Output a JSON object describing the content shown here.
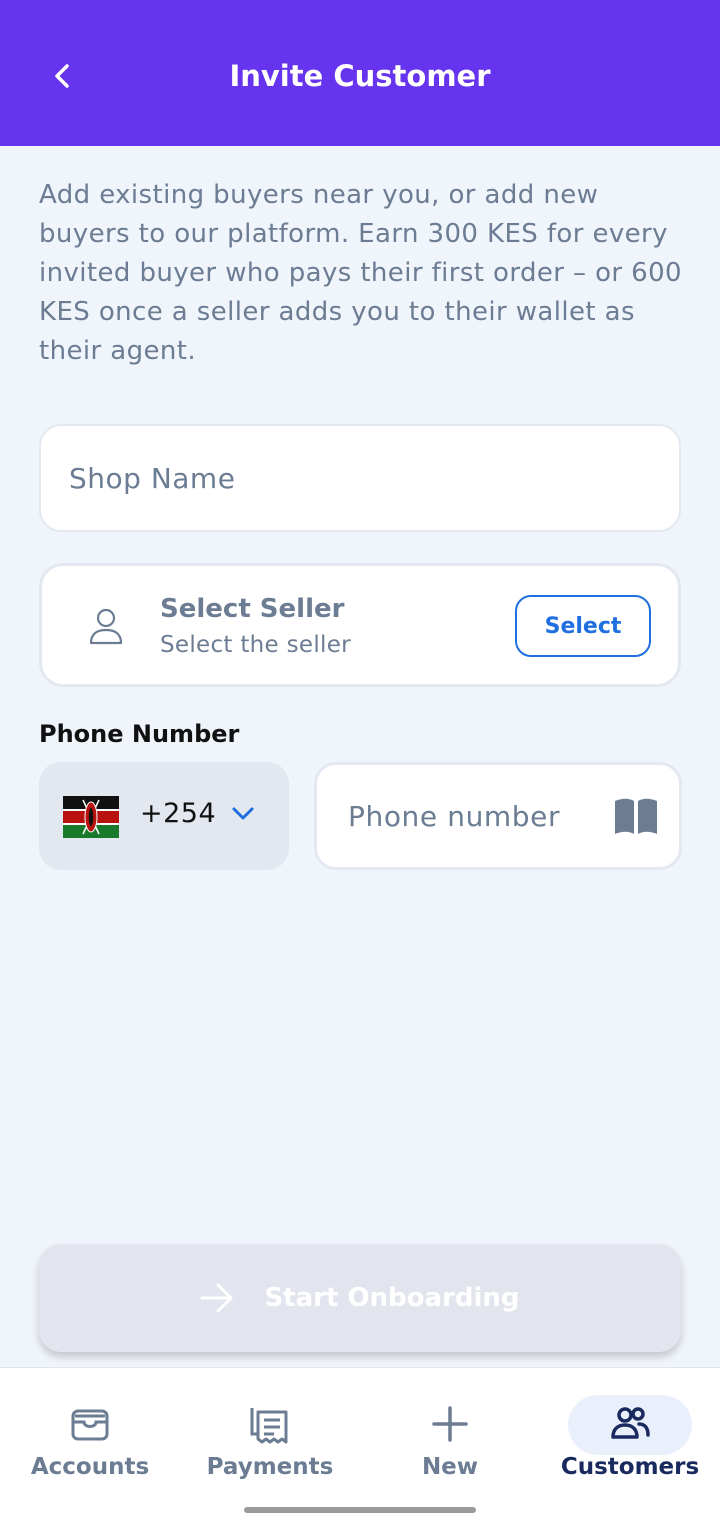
{
  "header": {
    "title": "Invite Customer"
  },
  "intro_text": "Add existing buyers near you, or add new buyers to our platform. Earn 300 KES for every invited buyer who pays their first order – or 600 KES once a seller adds you to their wallet as their agent.",
  "form": {
    "shop_name_placeholder": "Shop Name",
    "seller": {
      "title": "Select Seller",
      "subtitle": "Select the seller",
      "button_label": "Select"
    },
    "phone": {
      "label": "Phone Number",
      "country_flag": "kenya-flag",
      "dial_code": "+254",
      "placeholder": "Phone number"
    },
    "submit_label": "Start Onboarding"
  },
  "bottom_nav": {
    "items": [
      {
        "label": "Accounts",
        "icon": "wallet-icon",
        "active": false
      },
      {
        "label": "Payments",
        "icon": "receipt-icon",
        "active": false
      },
      {
        "label": "New",
        "icon": "plus-icon",
        "active": false
      },
      {
        "label": "Customers",
        "icon": "users-icon",
        "active": true
      }
    ]
  },
  "colors": {
    "header": "#6633ee",
    "accent_blue": "#1f6fe0",
    "muted_text": "#6b7c93",
    "background": "#f0f4fb",
    "active_nav": "#1a2a5e"
  }
}
